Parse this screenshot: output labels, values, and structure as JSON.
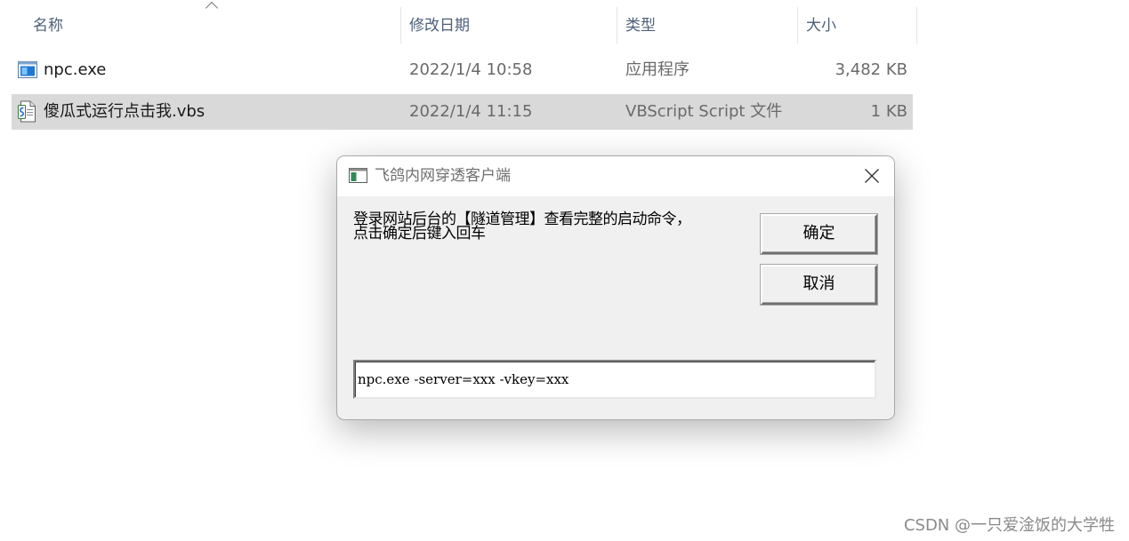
{
  "explorer": {
    "columns": {
      "name": "名称",
      "modified": "修改日期",
      "type": "类型",
      "size": "大小"
    },
    "files": [
      {
        "name": "npc.exe",
        "modified": "2022/1/4 10:58",
        "type": "应用程序",
        "size": "3,482 KB",
        "icon": "exe-app-icon",
        "selected": false
      },
      {
        "name": "傻瓜式运行点击我.vbs",
        "modified": "2022/1/4 11:15",
        "type": "VBScript Script 文件",
        "size": "1 KB",
        "icon": "vbs-script-icon",
        "selected": true
      }
    ]
  },
  "dialog": {
    "title": "飞鸽内网穿透客户端",
    "message": "登录网站后台的【隧道管理】查看完整的启动命令，\n点击确定后键入回车",
    "ok_label": "确定",
    "cancel_label": "取消",
    "input_value": "npc.exe -server=xxx -vkey=xxx"
  },
  "watermark": "CSDN @一只爱淦饭的大学牲",
  "colors": {
    "selection": "#d9d9d9",
    "header_text": "#4c607a",
    "dialog_bg": "#f0f0f0"
  }
}
